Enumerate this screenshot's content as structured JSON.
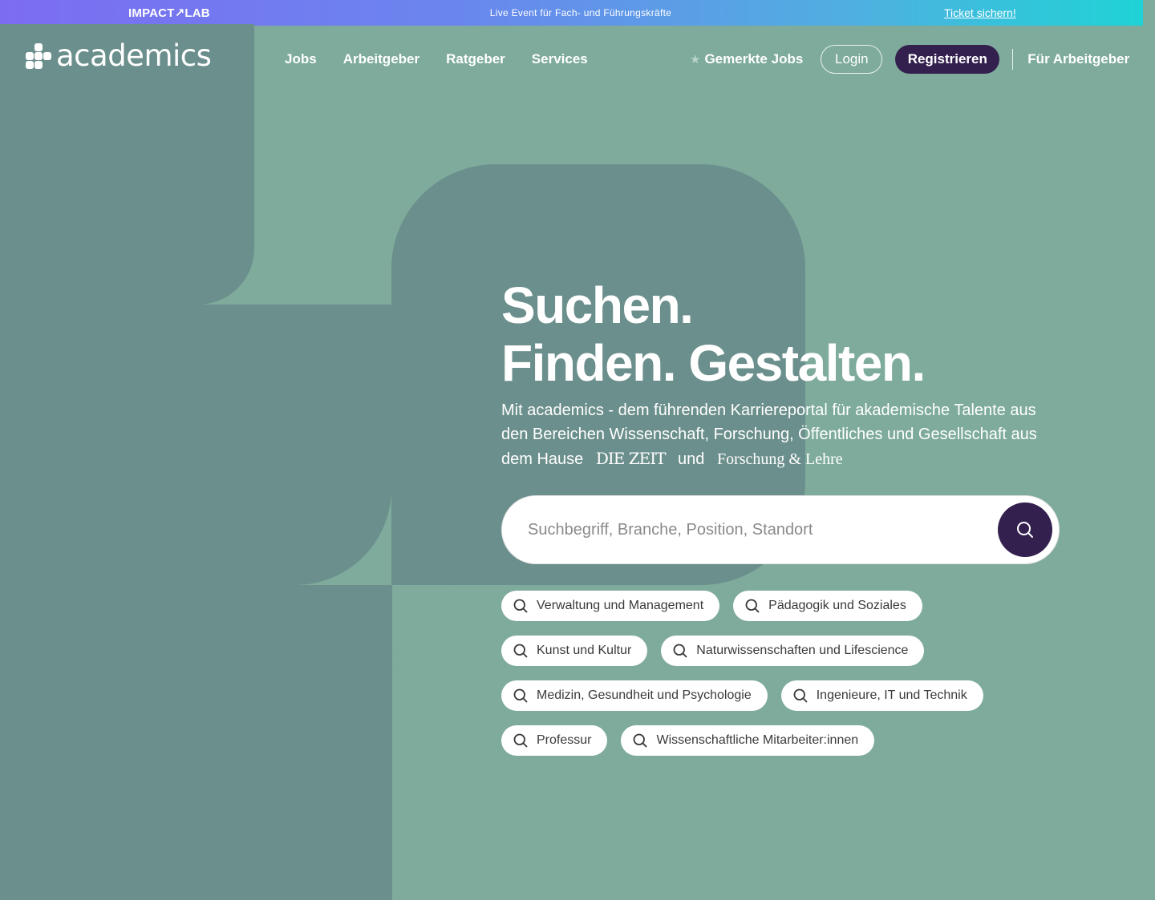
{
  "banner": {
    "brand": "IMPACT↗LAB",
    "event_text": "Live Event für Fach- und Führungskräfte",
    "cta": "Ticket sichern!"
  },
  "header": {
    "logo_text": "academics",
    "nav": [
      {
        "label": "Jobs"
      },
      {
        "label": "Arbeitgeber"
      },
      {
        "label": "Ratgeber"
      },
      {
        "label": "Services"
      }
    ],
    "saved_jobs": "Gemerkte Jobs",
    "login": "Login",
    "register": "Registrieren",
    "for_employers": "Für Arbeitgeber"
  },
  "hero": {
    "title_line1": "Suchen.",
    "title_line2": "Finden. Gestalten.",
    "subtitle": "Mit academics - dem führenden Karriereportal für akademische Talente aus den Bereichen Wissenschaft, Forschung, Öffentliches und Gesellschaft aus dem Hause",
    "partner1": "DIE ZEIT",
    "connector": "und",
    "partner2": "Forschung & Lehre"
  },
  "search": {
    "placeholder": "Suchbegriff, Branche, Position, Standort",
    "value": ""
  },
  "categories": [
    [
      "Verwaltung und Management",
      "Pädagogik und Soziales"
    ],
    [
      "Kunst und Kultur",
      "Naturwissenschaften und Lifescience"
    ],
    [
      "Medizin, Gesundheit und Psychologie",
      "Ingenieure, IT und Technik"
    ],
    [
      "Professur",
      "Wissenschaftliche Mitarbeiter:innen"
    ]
  ],
  "colors": {
    "background": "#7eab9c",
    "shape": "#6b8f8c",
    "primary": "#33204f"
  }
}
